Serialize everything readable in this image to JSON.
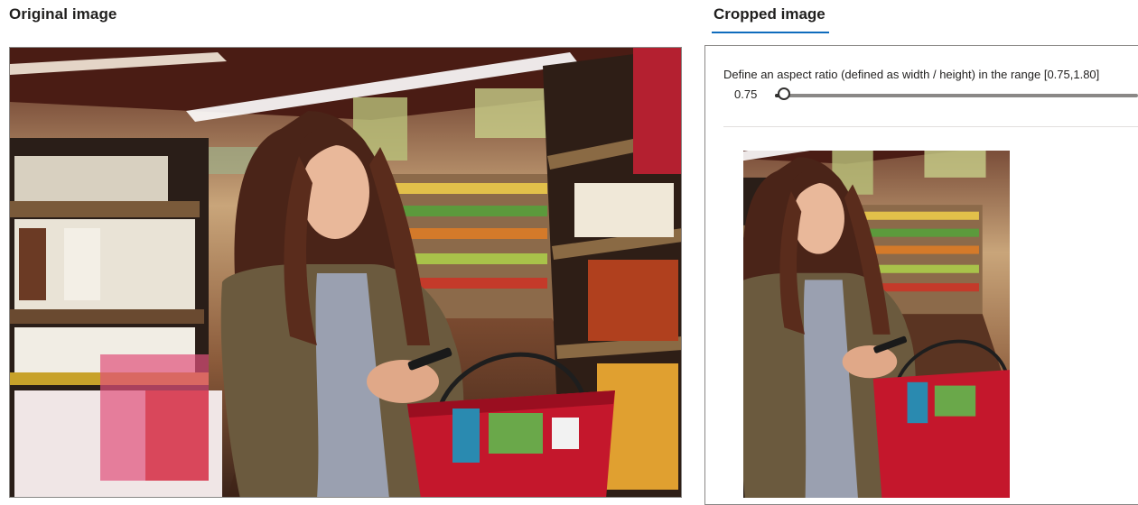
{
  "header": {
    "original_title": "Original image",
    "cropped_tab_label": "Cropped image"
  },
  "aspect": {
    "label": "Define an aspect ratio (defined as width / height) in the range [0.75,1.80]",
    "value": "0.75",
    "min": 0.75,
    "max": 1.8
  },
  "images": {
    "original_alt": "Woman in a grocery aisle holding a phone and a red basket",
    "cropped_alt": "Cropped view of woman in a grocery aisle"
  },
  "colors": {
    "accent": "#0f6cbd",
    "basket": "#c4172c",
    "jacket": "#6b5a3e",
    "hair": "#4a2418"
  }
}
